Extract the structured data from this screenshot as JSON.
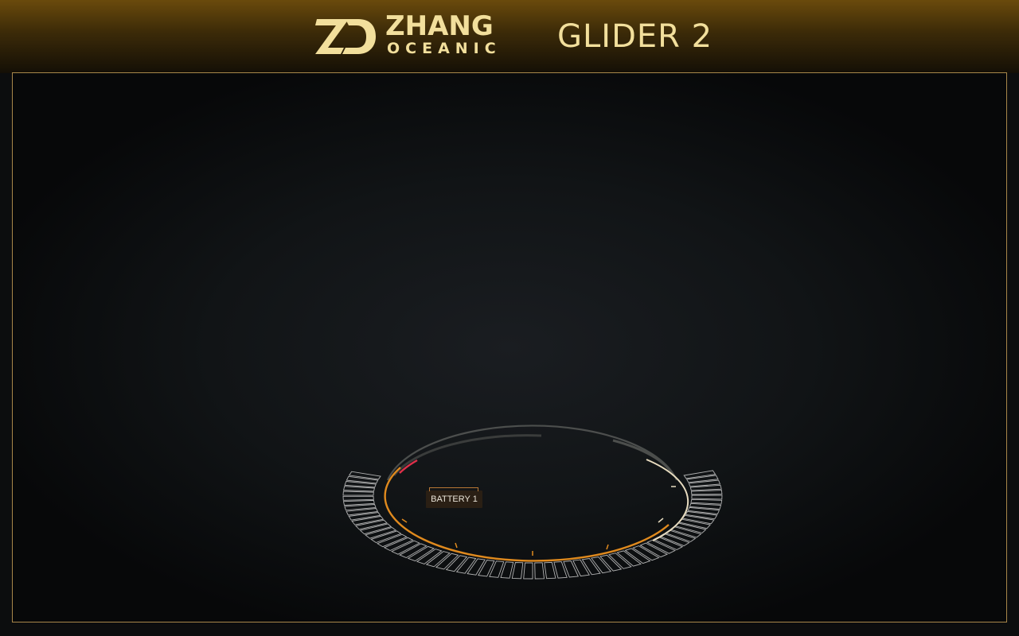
{
  "header": {
    "brand_top": "ZHANG",
    "brand_bottom": "OCEANIC",
    "product_title": "GLIDER 2",
    "logo_icon": "zd-monogram-icon"
  },
  "gauge": {
    "label": "BATTERY 1",
    "icon": "battery-ring-gauge"
  },
  "colors": {
    "accent_gold": "#f2df9c",
    "frame_border": "#a8874a",
    "arc_orange": "#e08a1e",
    "arc_red": "#e0304a",
    "tick_cream": "#e8dcc0"
  }
}
